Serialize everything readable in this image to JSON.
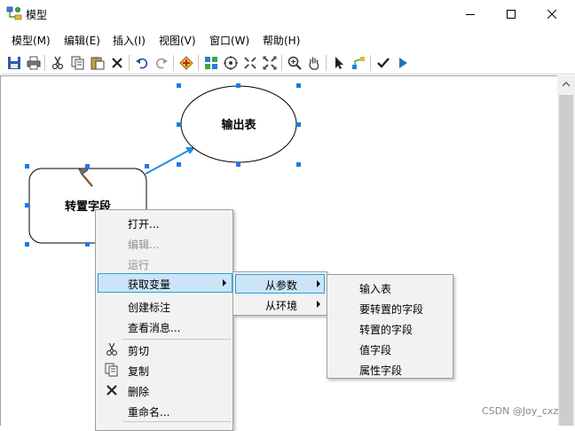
{
  "window": {
    "title": "模型",
    "app_icon": "model-icon",
    "controls": [
      "minimize-icon",
      "maximize-icon",
      "close-icon"
    ]
  },
  "menubar": {
    "items": [
      "模型(M)",
      "编辑(E)",
      "插入(I)",
      "视图(V)",
      "窗口(W)",
      "帮助(H)"
    ]
  },
  "toolbar": {
    "buttons": [
      "save-icon",
      "print-icon",
      "cut-icon",
      "copy-icon",
      "paste-icon",
      "delete-icon",
      "undo-icon",
      "redo-icon",
      "add-data-icon",
      "auto-layout-icon",
      "full-extent-icon",
      "zoom-in-fixed-icon",
      "zoom-out-fixed-icon",
      "zoom-icon",
      "pan-icon",
      "select-icon",
      "connect-icon",
      "validate-icon",
      "run-icon"
    ],
    "accent": "#1e72c4"
  },
  "diagram": {
    "input_node": {
      "label": "转置字段",
      "tool_icon": "hammer-icon"
    },
    "output_node": {
      "label": "输出表"
    },
    "connector_color": "#1e90e0",
    "handle_color": "#1e78e6"
  },
  "context_menu": {
    "items": [
      {
        "label": "打开...",
        "enabled": true
      },
      {
        "label": "编辑...",
        "enabled": false
      },
      {
        "label": "运行",
        "enabled": false
      },
      {
        "label": "获取变量",
        "enabled": true,
        "submenu": true,
        "highlighted": true
      },
      {
        "label": "创建标注",
        "enabled": true
      },
      {
        "label": "查看消息...",
        "enabled": true
      },
      {
        "label": "剪切",
        "enabled": true,
        "icon": "scissors-icon"
      },
      {
        "label": "复制",
        "enabled": true,
        "icon": "copy-icon"
      },
      {
        "label": "删除",
        "enabled": true,
        "icon": "delete-x-icon"
      },
      {
        "label": "重命名...",
        "enabled": true
      }
    ]
  },
  "submenu_1": {
    "items": [
      {
        "label": "从参数",
        "submenu": true,
        "highlighted": true
      },
      {
        "label": "从环境",
        "submenu": true
      }
    ]
  },
  "submenu_2": {
    "items": [
      "输入表",
      "要转置的字段",
      "转置的字段",
      "值字段",
      "属性字段"
    ]
  },
  "highlight_color": "#cce4f7",
  "watermark": "CSDN @Joy_cxz"
}
